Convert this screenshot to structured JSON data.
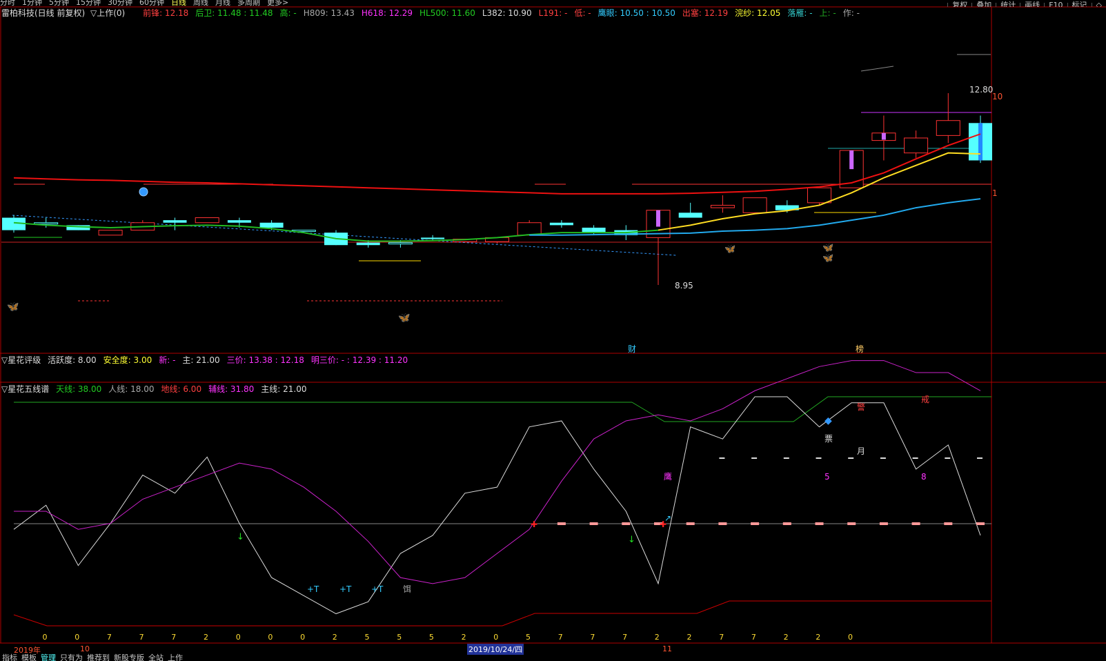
{
  "topbar": {
    "periods": [
      "分时",
      "1分钟",
      "5分钟",
      "15分钟",
      "30分钟",
      "60分钟",
      "日线",
      "周线",
      "月线",
      "多周期",
      "更多>"
    ],
    "active_period": "日线",
    "right_buttons": [
      "复权",
      "叠加",
      "统计",
      "画线",
      "F10",
      "标记",
      "◇"
    ]
  },
  "main_panel": {
    "stock_title": "雷柏科技(日线 前复权)",
    "indicator_name": "▽上作(0)",
    "labels": [
      {
        "text": "前锋: 12.18",
        "color": "#ff4040"
      },
      {
        "text": "后卫: 11.48 : 11.48",
        "color": "#22cc22"
      },
      {
        "text": "高: -",
        "color": "#22cc22"
      },
      {
        "text": "H809: 13.43",
        "color": "#aaaaaa"
      },
      {
        "text": "H618: 12.29",
        "color": "#ff33ff"
      },
      {
        "text": "HL500: 11.60",
        "color": "#22cc22"
      },
      {
        "text": "L382: 10.90",
        "color": "#dddddd"
      },
      {
        "text": "L191: -",
        "color": "#ff4040"
      },
      {
        "text": "低: -",
        "color": "#ff4040"
      },
      {
        "text": "鹰眼: 10.50 : 10.50",
        "color": "#33ccff"
      },
      {
        "text": "出塞: 12.19",
        "color": "#ff4040"
      },
      {
        "text": "浣纱: 12.05",
        "color": "#ffff33"
      },
      {
        "text": "落雁: -",
        "color": "#33cccc"
      },
      {
        "text": "上: -",
        "color": "#22aa22"
      },
      {
        "text": "作: -",
        "color": "#aaaaaa"
      }
    ],
    "high_label": "12.80",
    "low_label": "8.95",
    "right_labels": {
      "top": "10",
      "mid": "1"
    },
    "bottom_marks": [
      {
        "text": "财",
        "color": "#33ccff"
      },
      {
        "text": "榜",
        "color": "#ffcc66"
      }
    ]
  },
  "rating_panel": {
    "title": "▽星花评级",
    "labels": [
      {
        "text": "活跃度: 8.00",
        "color": "#dddddd"
      },
      {
        "text": "安全度: 3.00",
        "color": "#ffff33"
      },
      {
        "text": "新: -",
        "color": "#ff33ff"
      },
      {
        "text": "主: 21.00",
        "color": "#dddddd"
      },
      {
        "text": "三价: 13.38 : 12.18",
        "color": "#ff33ff"
      },
      {
        "text": "明三价: - : 12.39 : 11.20",
        "color": "#ff33ff"
      }
    ]
  },
  "line_panel": {
    "title": "▽星花五线谱",
    "labels": [
      {
        "text": "天线: 38.00",
        "color": "#22cc22"
      },
      {
        "text": "人线: 18.00",
        "color": "#aaaaaa"
      },
      {
        "text": "地线: 6.00",
        "color": "#ff4040"
      },
      {
        "text": "辅线: 31.80",
        "color": "#ff33ff"
      },
      {
        "text": "主线: 21.00",
        "color": "#dddddd"
      }
    ],
    "tags": [
      {
        "text": "+T",
        "color": "#33ccff"
      },
      {
        "text": "+T",
        "color": "#33ccff"
      },
      {
        "text": "+T",
        "color": "#33ccff"
      },
      {
        "text": "饵",
        "color": "#aaaaaa"
      },
      {
        "text": "鹰",
        "color": "#ff33ff"
      },
      {
        "text": "票",
        "color": "#dddddd"
      },
      {
        "text": "月",
        "color": "#dddddd"
      },
      {
        "text": "5",
        "color": "#ff33ff"
      },
      {
        "text": "8",
        "color": "#ff33ff"
      },
      {
        "text": "警",
        "color": "#ff4040"
      },
      {
        "text": "戒",
        "color": "#ff4040"
      }
    ],
    "bottom_digits": [
      "0",
      "0",
      "7",
      "7",
      "7",
      "2",
      "0",
      "0",
      "0",
      "2",
      "5",
      "5",
      "5",
      "2",
      "0",
      "5",
      "7",
      "7",
      "7",
      "2",
      "2",
      "7",
      "7",
      "2",
      "2",
      "0"
    ]
  },
  "date_axis": {
    "year": "2019年",
    "month_a": "10",
    "cursor_date": "2019/10/24/四",
    "month_b": "11"
  },
  "bottom_tabs": {
    "items": [
      "指标",
      "模板",
      "管理",
      "只有为",
      "推荐到",
      "新股专版",
      "全站",
      "上作"
    ],
    "active": "管理"
  },
  "chart_data": {
    "type": "candlestick",
    "candles": [
      {
        "o": 10.3,
        "h": 10.35,
        "c": 10.05,
        "l": 10.0,
        "dir": "down"
      },
      {
        "o": 10.2,
        "h": 10.3,
        "c": 10.2,
        "l": 10.1,
        "dir": "doji"
      },
      {
        "o": 10.15,
        "h": 10.15,
        "c": 10.05,
        "l": 10.05,
        "dir": "down"
      },
      {
        "o": 9.95,
        "h": 10.05,
        "c": 10.05,
        "l": 9.95,
        "dir": "up"
      },
      {
        "o": 10.05,
        "h": 10.25,
        "c": 10.2,
        "l": 10.05,
        "dir": "up"
      },
      {
        "o": 10.25,
        "h": 10.3,
        "c": 10.2,
        "l": 10.05,
        "dir": "down"
      },
      {
        "o": 10.2,
        "h": 10.3,
        "c": 10.3,
        "l": 10.2,
        "dir": "up"
      },
      {
        "o": 10.25,
        "h": 10.3,
        "c": 10.2,
        "l": 10.1,
        "dir": "down"
      },
      {
        "o": 10.2,
        "h": 10.25,
        "c": 10.1,
        "l": 10.05,
        "dir": "down"
      },
      {
        "o": 10.05,
        "h": 10.05,
        "c": 10.05,
        "l": 10.0,
        "dir": "doji"
      },
      {
        "o": 10.0,
        "h": 10.05,
        "c": 9.75,
        "l": 9.75,
        "dir": "down"
      },
      {
        "o": 9.8,
        "h": 9.85,
        "c": 9.75,
        "l": 9.7,
        "dir": "down"
      },
      {
        "o": 9.8,
        "h": 9.85,
        "c": 9.8,
        "l": 9.7,
        "dir": "doji"
      },
      {
        "o": 9.9,
        "h": 9.95,
        "c": 9.87,
        "l": 9.85,
        "dir": "down"
      },
      {
        "o": 9.82,
        "h": 9.87,
        "c": 9.87,
        "l": 9.8,
        "dir": "up"
      },
      {
        "o": 9.82,
        "h": 9.85,
        "c": 9.9,
        "l": 9.78,
        "dir": "up"
      },
      {
        "o": 9.95,
        "h": 10.25,
        "c": 10.2,
        "l": 9.95,
        "dir": "up"
      },
      {
        "o": 10.2,
        "h": 10.25,
        "c": 10.15,
        "l": 10.1,
        "dir": "down"
      },
      {
        "o": 10.1,
        "h": 10.15,
        "c": 10.0,
        "l": 9.95,
        "dir": "down"
      },
      {
        "o": 10.05,
        "h": 10.15,
        "c": 9.95,
        "l": 9.85,
        "dir": "down"
      },
      {
        "o": 9.9,
        "h": 10.45,
        "c": 10.45,
        "l": 8.95,
        "dir": "up"
      },
      {
        "o": 10.4,
        "h": 10.6,
        "c": 10.3,
        "l": 10.3,
        "dir": "down"
      },
      {
        "o": 10.5,
        "h": 10.75,
        "c": 10.55,
        "l": 10.4,
        "dir": "up"
      },
      {
        "o": 10.4,
        "h": 10.7,
        "c": 10.7,
        "l": 10.4,
        "dir": "up"
      },
      {
        "o": 10.55,
        "h": 10.65,
        "c": 10.45,
        "l": 10.4,
        "dir": "down"
      },
      {
        "o": 10.6,
        "h": 10.9,
        "c": 10.9,
        "l": 10.55,
        "dir": "up"
      },
      {
        "o": 10.9,
        "h": 11.65,
        "c": 11.65,
        "l": 10.9,
        "dir": "up"
      },
      {
        "o": 11.85,
        "h": 12.35,
        "c": 12.0,
        "l": 11.45,
        "dir": "up"
      },
      {
        "o": 11.6,
        "h": 12.05,
        "c": 11.9,
        "l": 11.5,
        "dir": "up"
      },
      {
        "o": 11.95,
        "h": 12.8,
        "c": 12.25,
        "l": 11.8,
        "dir": "up"
      },
      {
        "o": 12.2,
        "h": 12.35,
        "c": 11.45,
        "l": 11.4,
        "dir": "down"
      }
    ],
    "ma_red": [
      11.1,
      11.08,
      11.06,
      11.05,
      11.03,
      11.01,
      11.0,
      10.98,
      10.96,
      10.94,
      10.92,
      10.9,
      10.88,
      10.86,
      10.84,
      10.82,
      10.8,
      10.78,
      10.78,
      10.78,
      10.78,
      10.79,
      10.81,
      10.83,
      10.87,
      10.92,
      11.0,
      11.2,
      11.48,
      11.75,
      11.98
    ],
    "ma_green": [
      10.2,
      10.15,
      10.12,
      10.1,
      10.12,
      10.14,
      10.15,
      10.13,
      10.08,
      10.0,
      9.88,
      9.83,
      9.83,
      9.84,
      9.86,
      9.9,
      9.96,
      10.0,
      10.0,
      10.0,
      10.05,
      null,
      null,
      null,
      null,
      null,
      null,
      null,
      null,
      null,
      null
    ],
    "ma_yellow": [
      null,
      null,
      null,
      null,
      null,
      null,
      null,
      null,
      null,
      null,
      null,
      null,
      null,
      null,
      null,
      null,
      null,
      null,
      null,
      null,
      10.05,
      10.15,
      10.28,
      10.38,
      10.44,
      10.55,
      10.8,
      11.1,
      11.35,
      11.6,
      11.58
    ],
    "ma_blue": [
      null,
      null,
      null,
      null,
      null,
      null,
      null,
      null,
      null,
      null,
      null,
      null,
      null,
      null,
      null,
      null,
      9.95,
      9.95,
      9.96,
      9.97,
      9.98,
      9.99,
      10.03,
      10.05,
      10.08,
      10.15,
      10.25,
      10.35,
      10.5,
      10.6,
      10.68
    ],
    "line_white": [
      16,
      20,
      10,
      17,
      25,
      22,
      28,
      17,
      8,
      5,
      2,
      4,
      12,
      15,
      22,
      23,
      33,
      34,
      26,
      19,
      7,
      33,
      31,
      38,
      38,
      33,
      37,
      37,
      26,
      30,
      15
    ],
    "line_magenta": [
      19,
      19,
      16,
      17,
      21,
      23,
      25,
      27,
      26,
      23,
      19,
      14,
      8,
      7,
      8,
      12,
      16,
      24,
      31,
      34,
      35,
      34,
      36,
      39,
      41,
      43,
      44,
      44,
      42,
      42,
      39
    ]
  }
}
